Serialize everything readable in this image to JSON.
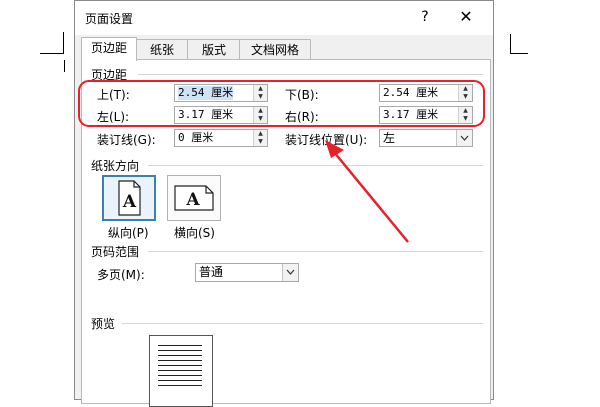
{
  "dialog": {
    "title": "页面设置",
    "help": "?",
    "close": "✕",
    "tabs": [
      "页边距",
      "纸张",
      "版式",
      "文档网格"
    ]
  },
  "margins": {
    "section_title": "页边距",
    "top_label": "上(T):",
    "top_value": "2.54 厘米",
    "bottom_label": "下(B):",
    "bottom_value": "2.54 厘米",
    "left_label": "左(L):",
    "left_value": "3.17 厘米",
    "right_label": "右(R):",
    "right_value": "3.17 厘米",
    "gutter_label": "装订线(G):",
    "gutter_value": "0 厘米",
    "gutter_pos_label": "装订线位置(U):",
    "gutter_pos_value": "左"
  },
  "orientation": {
    "section_title": "纸张方向",
    "portrait_label": "纵向(P)",
    "landscape_label": "横向(S)",
    "icon_letter": "A",
    "selected": "portrait"
  },
  "pages": {
    "section_title": "页码范围",
    "multiple_label": "多页(M):",
    "multiple_value": "普通"
  },
  "preview": {
    "section_title": "预览"
  },
  "annotation": {
    "color": "#e8202a"
  },
  "colors": {
    "selection": "#cfe3f7",
    "selected_border": "#3c7fb1"
  },
  "icons": {
    "spin_up": "▲",
    "spin_down": "▼",
    "dropdown": "chevron-down-icon",
    "portrait": "portrait-page-icon",
    "landscape": "landscape-page-icon"
  }
}
